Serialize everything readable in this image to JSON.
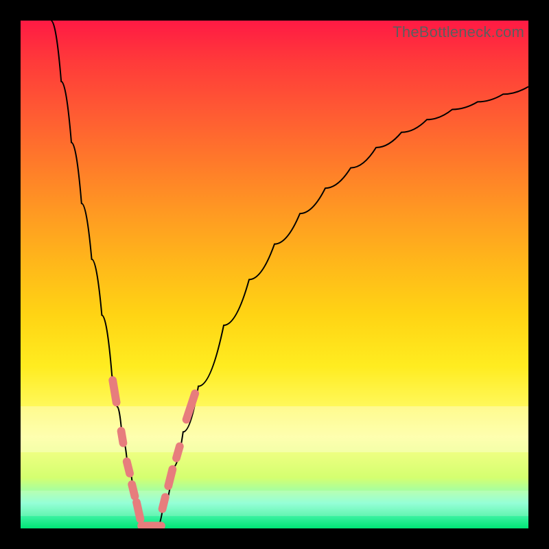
{
  "attribution": "TheBottleneck.com",
  "colors": {
    "gradient_top": "#ff1a44",
    "gradient_bottom": "#00e676",
    "curve": "#000000",
    "marker": "#e77d7d",
    "frame": "#000000"
  },
  "chart_data": {
    "type": "line",
    "title": "",
    "xlabel": "",
    "ylabel": "",
    "xlim": [
      0,
      100
    ],
    "ylim": [
      0,
      100
    ],
    "series": [
      {
        "name": "left_branch",
        "x": [
          6,
          8,
          10,
          12,
          14,
          16,
          18,
          19,
          20,
          21,
          22,
          23,
          24
        ],
        "y": [
          100,
          88,
          76,
          64,
          53,
          42,
          30,
          24,
          18,
          13,
          9,
          5,
          0.5
        ]
      },
      {
        "name": "right_branch",
        "x": [
          27,
          28,
          30,
          32,
          35,
          40,
          45,
          50,
          55,
          60,
          65,
          70,
          75,
          80,
          85,
          90,
          95,
          100
        ],
        "y": [
          0.5,
          4,
          12,
          19,
          28,
          40,
          49,
          56,
          62,
          67,
          71,
          75,
          78,
          80.5,
          82.5,
          84,
          85.5,
          87
        ]
      },
      {
        "name": "bottom_flat",
        "x": [
          24,
          25.5,
          27
        ],
        "y": [
          0.5,
          0.5,
          0.5
        ]
      }
    ],
    "markers": [
      {
        "branch": "left",
        "x": 18.5,
        "y": 27,
        "len": 6
      },
      {
        "branch": "left",
        "x": 20.0,
        "y": 18,
        "len": 4
      },
      {
        "branch": "left",
        "x": 21.2,
        "y": 12,
        "len": 4
      },
      {
        "branch": "left",
        "x": 22.2,
        "y": 7.5,
        "len": 4
      },
      {
        "branch": "left",
        "x": 23.2,
        "y": 3.5,
        "len": 5
      },
      {
        "branch": "flat",
        "x": 25.0,
        "y": 0.5,
        "len": 4
      },
      {
        "branch": "flat",
        "x": 26.5,
        "y": 0.5,
        "len": 4
      },
      {
        "branch": "right",
        "x": 28.2,
        "y": 5,
        "len": 4
      },
      {
        "branch": "right",
        "x": 29.5,
        "y": 10,
        "len": 5
      },
      {
        "branch": "right",
        "x": 31.0,
        "y": 15,
        "len": 4
      },
      {
        "branch": "right",
        "x": 33.5,
        "y": 24,
        "len": 7
      }
    ],
    "marker_style": {
      "shape": "capsule",
      "width_pct": 1.6
    },
    "highlight_bands": [
      {
        "y_top_pct": 76,
        "y_bottom_pct": 85
      },
      {
        "y_top_pct": 92.5,
        "y_bottom_pct": 97.5
      }
    ]
  }
}
